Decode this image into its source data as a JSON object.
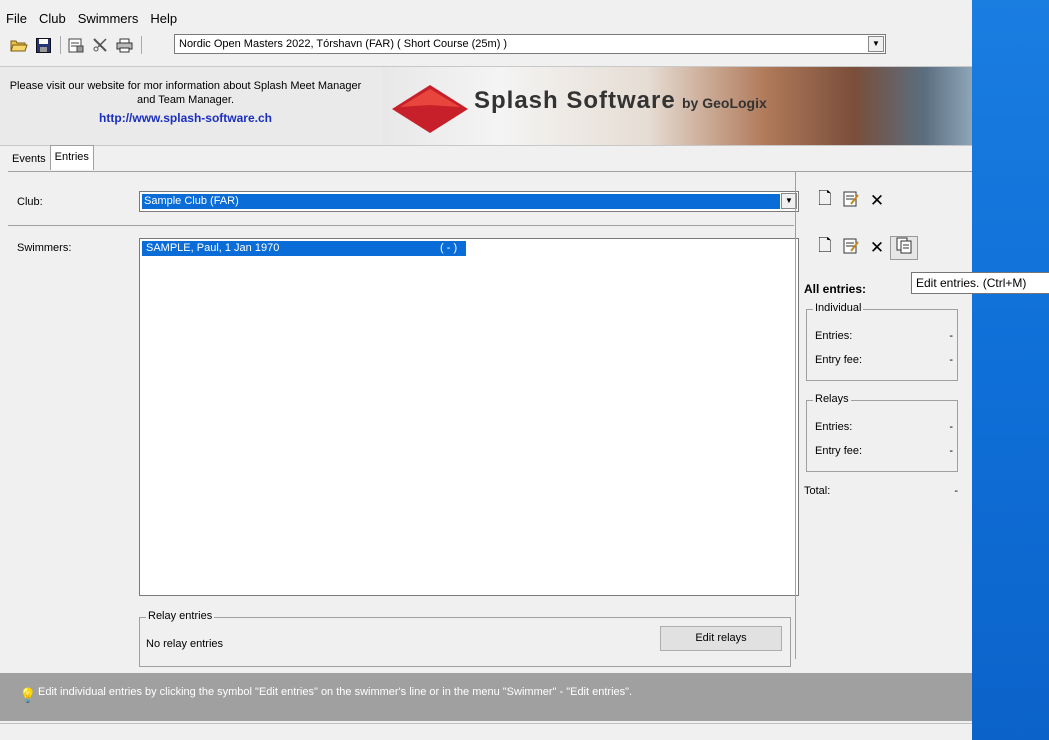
{
  "menu": [
    "File",
    "Club",
    "Swimmers",
    "Help"
  ],
  "toolbar": {
    "icons": [
      "open-folder-icon",
      "save-icon",
      "properties-icon",
      "tools-icon",
      "print-icon"
    ],
    "meet_select": "Nordic Open Masters 2022,  Tórshavn  (FAR)  ( Short Course (25m) )"
  },
  "banner": {
    "text": "Please visit our website for mor information about Splash Meet Manager and Team Manager.",
    "link": "http://www.splash-software.ch",
    "brand": "Splash Software",
    "by": "by GeoLogix"
  },
  "tabs": [
    "Events",
    "Entries"
  ],
  "club": {
    "label": "Club:",
    "value": "Sample Club (FAR)"
  },
  "swimmers": {
    "label": "Swimmers:",
    "rows": [
      {
        "name": "SAMPLE, Paul, 1 Jan 1970",
        "flag": "( - )"
      }
    ]
  },
  "relay": {
    "legend": "Relay entries",
    "text": "No relay entries",
    "button": "Edit relays"
  },
  "summary": {
    "title": "All entries:",
    "individual": {
      "legend": "Individual",
      "entries_label": "Entries:",
      "entries_value": "-",
      "fee_label": "Entry fee:",
      "fee_value": "-"
    },
    "relays": {
      "legend": "Relays",
      "entries_label": "Entries:",
      "entries_value": "-",
      "fee_label": "Entry fee:",
      "fee_value": "-"
    },
    "total_label": "Total:",
    "total_value": "-"
  },
  "tooltip": "Edit entries. (Ctrl+M)",
  "status": "Edit individual entries by clicking the symbol \"Edit entries\" on the swimmer's line or in the menu \"Swimmer\" - \"Edit entries\".",
  "colors": {
    "selection": "#0a6cd7",
    "status_bg": "#a0a0a0",
    "desktop": "#0f6fd8",
    "link": "#1a2fbe"
  }
}
